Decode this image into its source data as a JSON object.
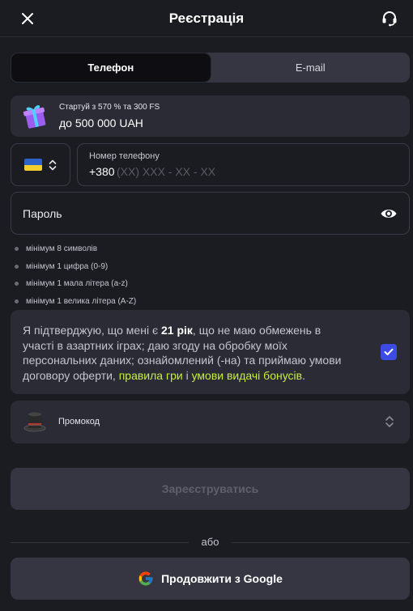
{
  "header": {
    "title": "Реєстрація",
    "close_icon": "close-icon",
    "support_icon": "headset-icon"
  },
  "tabs": [
    {
      "label": "Телефон",
      "active": true
    },
    {
      "label": "E-mail",
      "active": false
    }
  ],
  "bonus": {
    "line1": "Стартуй з 570 % та 300 FS",
    "line2": "до 500 000 UAH",
    "icon": "gift-icon"
  },
  "phone": {
    "country_flag": "ukraine-flag-icon",
    "label": "Номер телефону",
    "value": "+380",
    "placeholder": "(XX) XXX - XX - XX"
  },
  "password": {
    "placeholder": "Пароль",
    "icon": "eye-icon"
  },
  "password_rules": [
    "мінімум 8 символів",
    "мінімум 1 цифра (0-9)",
    "мінімум 1 мала літера (a-z)",
    "мінімум 1 велика літера (A-Z)"
  ],
  "consent": {
    "part1": "Я підтверджую, що мені є ",
    "age": "21 рік",
    "part2": ", що не маю обмежень в участі в азартних іграх; даю згоду на обробку моїх персональних даних; ознайомлений (-на) та приймаю умови договору оферти, ",
    "link1": "правила гри",
    "part3": " і ",
    "link2": "умови видачі бонусів",
    "part4": ".",
    "checked": true
  },
  "promo": {
    "label": "Промокод",
    "icon": "magic-hat-icon"
  },
  "register_button": "Зареєструватись",
  "divider_text": "або",
  "google_button": "Продовжити з Google",
  "colors": {
    "background": "#1b1b22",
    "card": "#2b2b36",
    "accent": "#3d4be5",
    "link": "#c7ee3a"
  }
}
